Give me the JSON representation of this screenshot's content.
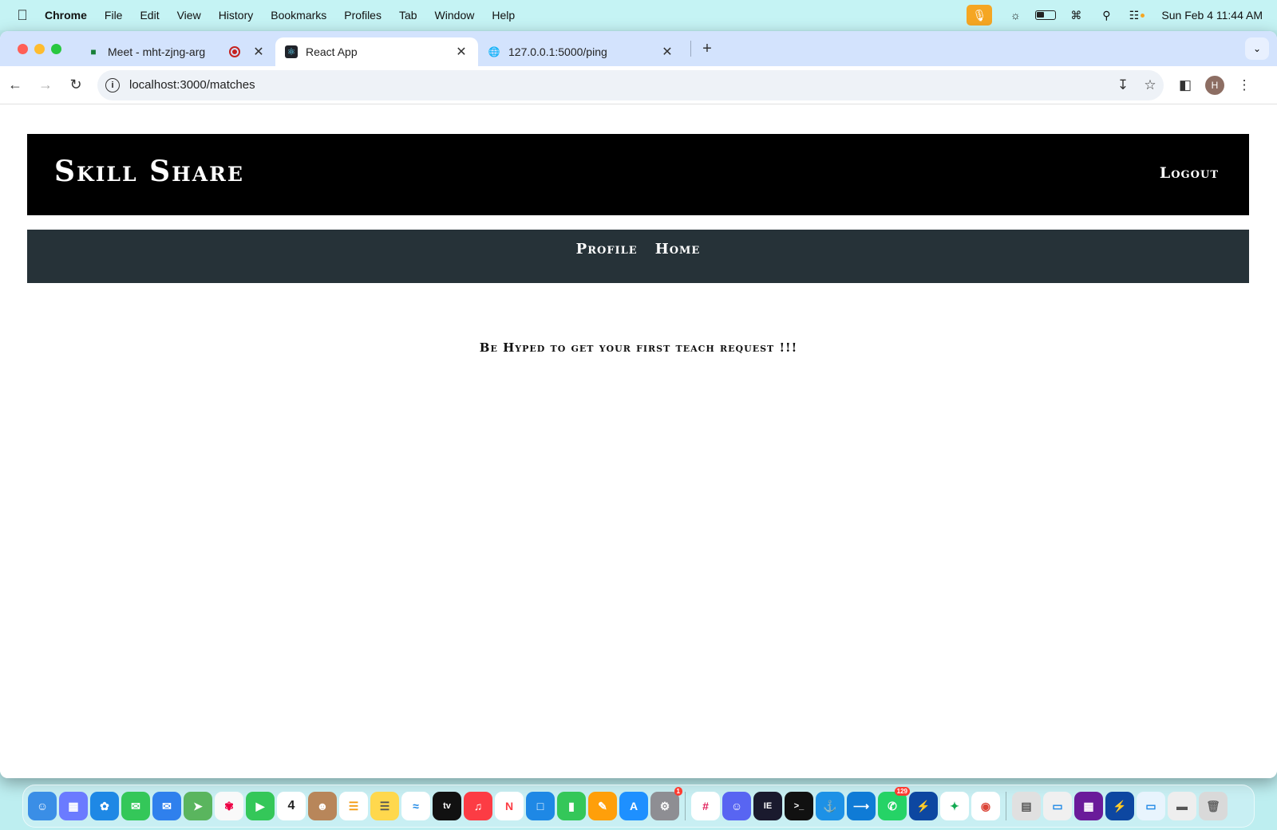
{
  "menubar": {
    "app": "Chrome",
    "items": [
      "File",
      "Edit",
      "View",
      "History",
      "Bookmarks",
      "Profiles",
      "Tab",
      "Window",
      "Help"
    ],
    "clock": "Sun Feb 4  11:44 AM"
  },
  "tabs": [
    {
      "title": "Meet - mht-zjng-arg",
      "active": false
    },
    {
      "title": "React App",
      "active": true
    },
    {
      "title": "127.0.0.1:5000/ping",
      "active": false
    }
  ],
  "toolbar": {
    "url": "localhost:3000/matches",
    "avatar_initial": "H"
  },
  "site": {
    "brand": "Skill Share",
    "logout": "Logout",
    "nav": [
      "Profile",
      "Home"
    ],
    "message": "Be Hyped to get your first teach request !!!"
  },
  "dock": {
    "calendar_day": "4",
    "whatsapp_badge": "129",
    "settings_badge": "1"
  }
}
